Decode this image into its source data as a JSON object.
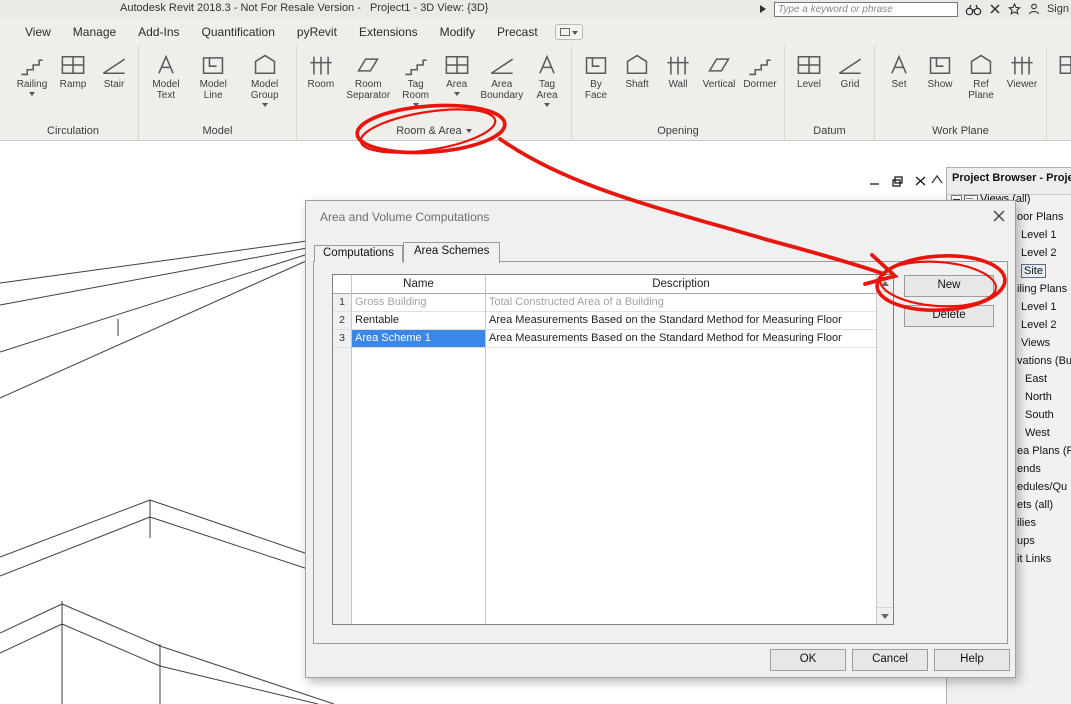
{
  "colors": {
    "annotation_red": "#e8150d",
    "selection_blue": "#3b87e8"
  },
  "title_bar": {
    "title": "Autodesk Revit 2018.3 - Not For Resale Version -   Project1 - 3D View: {3D}",
    "search_placeholder": "Type a keyword or phrase",
    "sign_label": "Sign"
  },
  "ribbon_tabs": [
    "View",
    "Manage",
    "Add-Ins",
    "Quantification",
    "pyRevit",
    "Extensions",
    "Modify",
    "Precast"
  ],
  "ribbon_groups": [
    {
      "label": "Circulation",
      "has_dropdown": false,
      "buttons": [
        {
          "label": "Railing",
          "dropdown": true
        },
        {
          "label": "Ramp",
          "dropdown": false
        },
        {
          "label": "Stair",
          "dropdown": false
        }
      ]
    },
    {
      "label": "Model",
      "has_dropdown": false,
      "buttons": [
        {
          "label": "Model Text",
          "dropdown": false
        },
        {
          "label": "Model Line",
          "dropdown": false
        },
        {
          "label": "Model Group",
          "dropdown": true
        }
      ]
    },
    {
      "label": "Room & Area",
      "has_dropdown": true,
      "buttons": [
        {
          "label": "Room",
          "dropdown": false
        },
        {
          "label": "Room Separator",
          "dropdown": false
        },
        {
          "label": "Tag Room",
          "dropdown": true
        },
        {
          "label": "Area",
          "dropdown": true
        },
        {
          "label": "Area Boundary",
          "dropdown": false
        },
        {
          "label": "Tag Area",
          "dropdown": true
        }
      ]
    },
    {
      "label": "Opening",
      "has_dropdown": false,
      "buttons": [
        {
          "label": "By Face",
          "dropdown": false
        },
        {
          "label": "Shaft",
          "dropdown": false
        },
        {
          "label": "Wall",
          "dropdown": false
        },
        {
          "label": "Vertical",
          "dropdown": false
        },
        {
          "label": "Dormer",
          "dropdown": false
        }
      ]
    },
    {
      "label": "Datum",
      "has_dropdown": false,
      "buttons": [
        {
          "label": "Level",
          "dropdown": false
        },
        {
          "label": "Grid",
          "dropdown": false
        }
      ]
    },
    {
      "label": "Work Plane",
      "has_dropdown": false,
      "buttons": [
        {
          "label": "Set",
          "dropdown": false
        },
        {
          "label": "Show",
          "dropdown": false
        },
        {
          "label": "Ref Plane",
          "dropdown": false
        },
        {
          "label": "Viewer",
          "dropdown": false
        }
      ]
    }
  ],
  "dialog": {
    "title": "Area and Volume Computations",
    "tabs": [
      "Computations",
      "Area Schemes"
    ],
    "active_tab": "Area Schemes",
    "table": {
      "headers": [
        "Name",
        "Description"
      ],
      "rows": [
        {
          "num": "1",
          "name": "Gross Building",
          "description": "Total Constructed Area of a Building",
          "state": "disabled"
        },
        {
          "num": "2",
          "name": "Rentable",
          "description": "Area Measurements Based on the Standard Method for Measuring Floor",
          "state": "normal"
        },
        {
          "num": "3",
          "name": "Area Scheme 1",
          "description": "Area Measurements Based on the Standard Method for Measuring Floor",
          "state": "selected"
        }
      ]
    },
    "buttons": {
      "new_label": "New",
      "delete_label": "Delete",
      "ok_label": "OK",
      "cancel_label": "Cancel",
      "help_label": "Help"
    }
  },
  "project_browser": {
    "title": "Project Browser - Proje",
    "items": [
      {
        "label": "Views (all)",
        "indent": 0,
        "has_expander": true,
        "selected": false
      },
      {
        "label": "oor Plans",
        "indent": 1,
        "selected": false
      },
      {
        "label": "Level 1",
        "indent": 2,
        "selected": false
      },
      {
        "label": "Level 2",
        "indent": 2,
        "selected": false
      },
      {
        "label": "Site",
        "indent": 2,
        "selected": true
      },
      {
        "label": "iling Plans",
        "indent": 1,
        "selected": false
      },
      {
        "label": "Level 1",
        "indent": 2,
        "selected": false
      },
      {
        "label": "Level 2",
        "indent": 2,
        "selected": false
      },
      {
        "label": "Views",
        "indent": 2,
        "selected": false
      },
      {
        "label": "vations (Bu",
        "indent": 1,
        "selected": false
      },
      {
        "label": "East",
        "indent": 3,
        "selected": false
      },
      {
        "label": "North",
        "indent": 3,
        "selected": false
      },
      {
        "label": "South",
        "indent": 3,
        "selected": false
      },
      {
        "label": "West",
        "indent": 3,
        "selected": false
      },
      {
        "label": "ea Plans (R",
        "indent": 1,
        "selected": false
      },
      {
        "label": "ends",
        "indent": 1,
        "selected": false
      },
      {
        "label": "edules/Qu",
        "indent": 1,
        "selected": false
      },
      {
        "label": "ets (all)",
        "indent": 1,
        "selected": false
      },
      {
        "label": "ilies",
        "indent": 1,
        "selected": false
      },
      {
        "label": "ups",
        "indent": 1,
        "selected": false
      },
      {
        "label": "it Links",
        "indent": 1,
        "selected": false
      }
    ]
  }
}
